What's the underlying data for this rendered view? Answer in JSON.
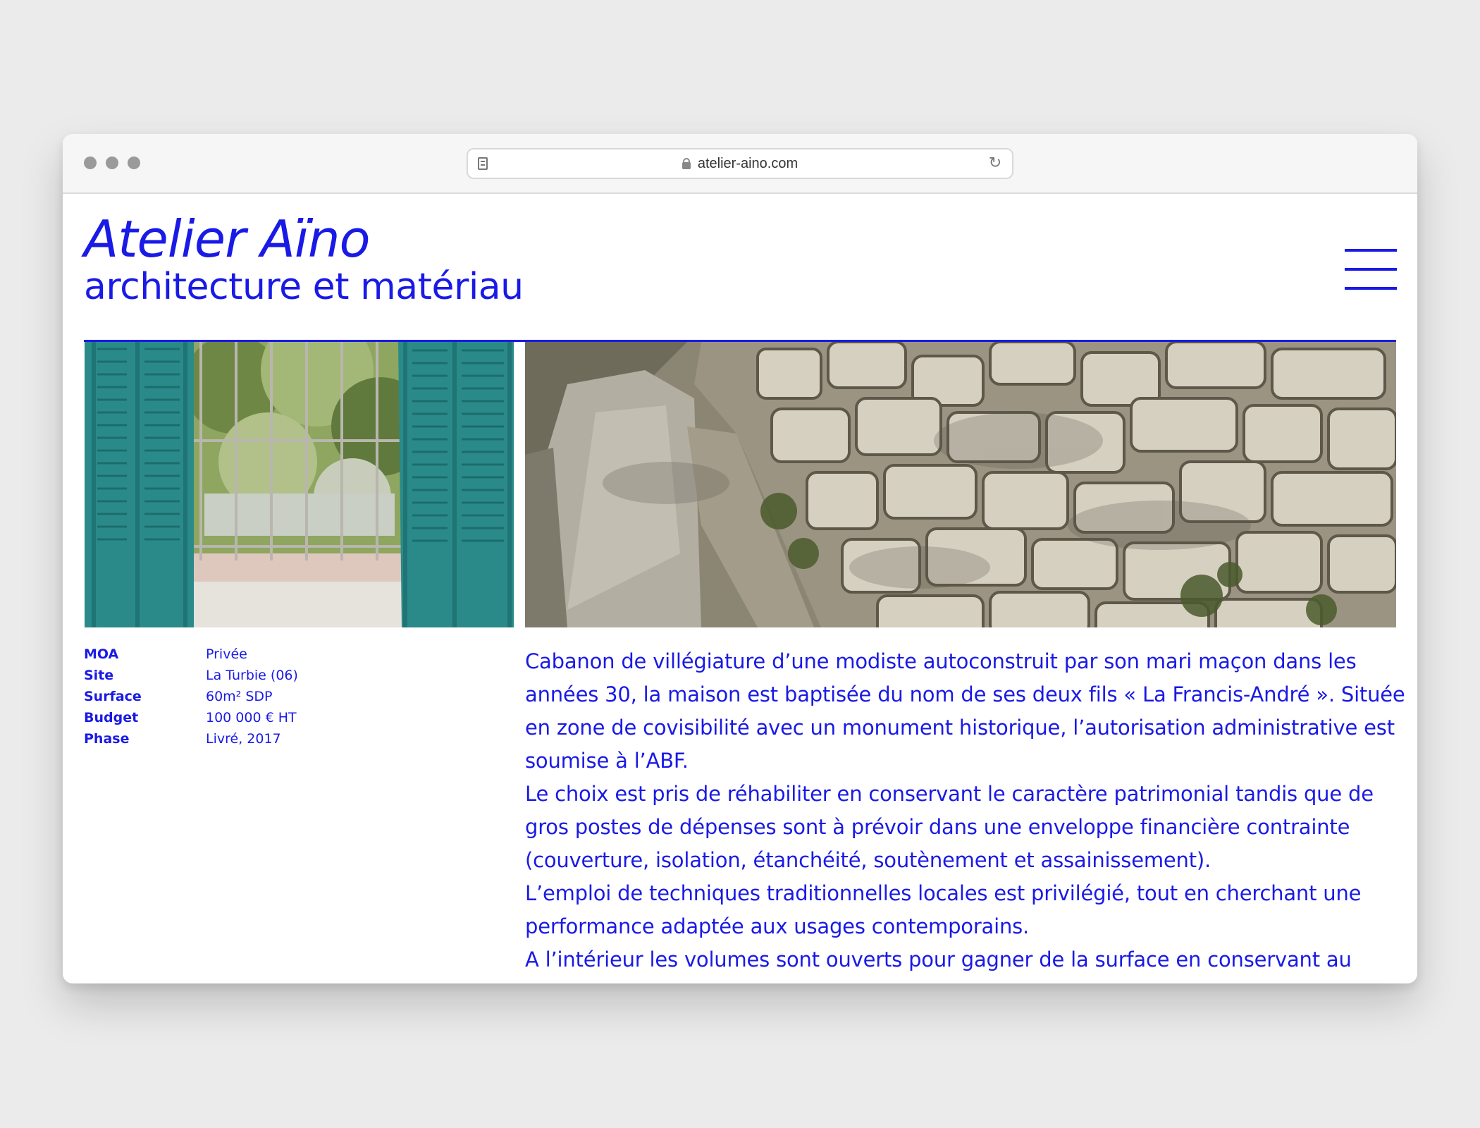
{
  "browser": {
    "url": "atelier-aino.com",
    "traffic_color": "#9a9a9a"
  },
  "site": {
    "brand_name": "Atelier Aïno",
    "tagline": "architecture et matériau",
    "accent_color": "#1a1ae6"
  },
  "project": {
    "facts": [
      {
        "label": "MOA",
        "value": "Privée"
      },
      {
        "label": "Site",
        "value": "La Turbie (06)"
      },
      {
        "label": "Surface",
        "value": "60m² SDP"
      },
      {
        "label": "Budget",
        "value": "100 000 € HT"
      },
      {
        "label": "Phase",
        "value": "Livré, 2017"
      }
    ],
    "description": [
      "Cabanon de villégiature d’une modiste autoconstruit par son mari maçon dans les années 30, la maison est baptisée du nom de ses deux fils « La Francis-André ». Située en zone de covisibilité avec un monument historique, l’autorisation administrative est soumise à l’ABF.",
      "Le choix est pris de réhabiliter en conservant le caractère patrimonial tandis que de gros postes de dépenses sont à prévoir dans une enveloppe financière contrainte (couverture, isolation, étanchéité, soutènement et assainissement).",
      "L’emploi de techniques traditionnelles locales est privilégié, tout en cherchant une performance adaptée aux usages contemporains.",
      "A l’intérieur les volumes sont ouverts pour gagner de la surface en conservant au"
    ]
  }
}
